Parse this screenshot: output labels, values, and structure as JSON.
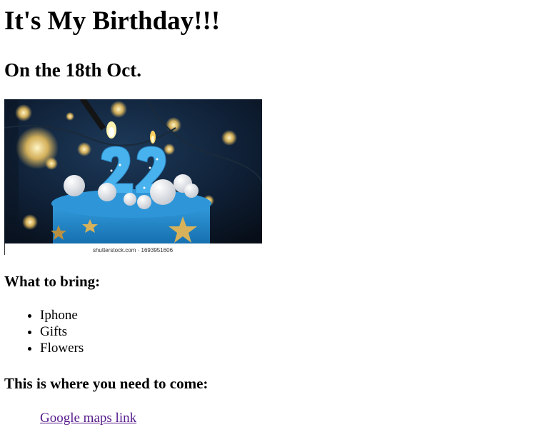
{
  "page": {
    "title": "It's My Birthday!!!",
    "date_heading": "On the 18th Oct.",
    "image": {
      "icon": "birthday-cake-image",
      "candle_number": "22",
      "caption": "shutterstock.com · 1693951606"
    },
    "bring_heading": "What to bring:",
    "bring_items": [
      "Iphone",
      "Gifts",
      "Flowers"
    ],
    "where_heading": "This is where you need to come:",
    "map_link_label": "Google maps link"
  },
  "colors": {
    "visited_link": "#551a8b",
    "cake_blue": "#2a8fd0",
    "background_dark": "#0d1a2a"
  }
}
